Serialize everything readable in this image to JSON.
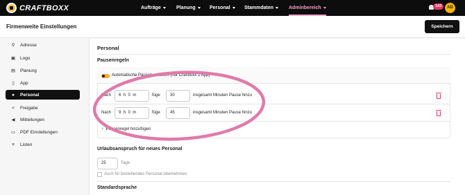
{
  "nav": {
    "brand": "CRAFTBOXX",
    "items": [
      {
        "label": "Aufträge"
      },
      {
        "label": "Planung"
      },
      {
        "label": "Personal"
      },
      {
        "label": "Stammdaten"
      },
      {
        "label": "Adminbereich"
      }
    ],
    "notification_count": "143",
    "avatar_initials": "AD",
    "accent": "#f2a0c6"
  },
  "header": {
    "title": "Firmenweite Einstellungen",
    "save_label": "Speichern"
  },
  "sidebar": {
    "items": [
      {
        "label": "Adresse",
        "icon": "map-pin-icon",
        "glyph": "⚲"
      },
      {
        "label": "Logo",
        "icon": "image-icon",
        "glyph": "▣"
      },
      {
        "label": "Planung",
        "icon": "calendar-icon",
        "glyph": "▤"
      },
      {
        "label": "App",
        "icon": "phone-icon",
        "glyph": "▯"
      },
      {
        "label": "Personal",
        "icon": "user-icon",
        "glyph": "●"
      },
      {
        "label": "Freigabe",
        "icon": "share-icon",
        "glyph": "<"
      },
      {
        "label": "Mitteilungen",
        "icon": "megaphone-icon",
        "glyph": "◀"
      },
      {
        "label": "PDF Einstellungen",
        "icon": "document-icon",
        "glyph": "▭"
      },
      {
        "label": "Listen",
        "icon": "list-icon",
        "glyph": "≡"
      }
    ],
    "active_index": 4
  },
  "main": {
    "section_title": "Personal",
    "pause_rules": {
      "title": "Pausenregeln",
      "toggle_label": "Automatische Pausen erstellen (nur Craftboxx 2 App)",
      "toggle_on": true,
      "rules": [
        {
          "prefix": "Nach",
          "time": "6h0m",
          "middle": "füge",
          "minutes": "30",
          "suffix": "insgesamt Minuten Pause hinzu"
        },
        {
          "prefix": "Nach",
          "time": "9h0m",
          "middle": "füge",
          "minutes": "45",
          "suffix": "insgesamt Minuten Pause hinzu"
        }
      ],
      "add_label": "Pausenregel hinzufügen"
    },
    "vacation": {
      "title": "Urlaubsanspruch für neues Personal",
      "days": "25",
      "unit": "Tage",
      "checkbox_label": "Auch für bestehendes Personal übernehmen"
    },
    "language": {
      "title": "Standardsprache"
    }
  },
  "annotation_color": "#e07aaa"
}
